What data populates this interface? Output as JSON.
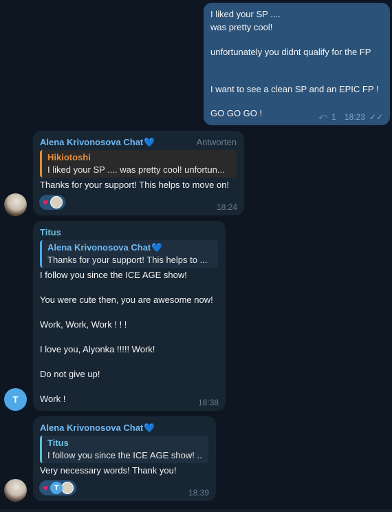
{
  "outgoing": {
    "lines": [
      "I liked your SP ....",
      "was pretty cool!",
      "unfortunately you didnt qualify for the FP",
      "I want to see a clean SP and an EPIC FP !",
      "GO GO GO !"
    ],
    "reply_count": "1",
    "time": "18:23"
  },
  "msg1": {
    "sender": "Alena Krivonosova Chat",
    "reply_action": "Antworten",
    "quote_name": "Hikiotoshi",
    "quote_text": "I liked your SP ....  was pretty cool!  unfortun...",
    "text": "Thanks for your support! This helps to move on!",
    "time": "18:24"
  },
  "msg2": {
    "sender": "Titus",
    "quote_name": "Alena Krivonosova Chat",
    "quote_text": "Thanks for your support! This helps to ...",
    "lines": [
      "I follow you since the ICE AGE show!",
      "You were cute then, you are awesome now!",
      "Work, Work, Work ! ! !",
      "I love you, Alyonka !!!!!  Work!",
      "Do not give up!",
      "Work !"
    ],
    "time": "18:38",
    "avatar_letter": "T"
  },
  "msg3": {
    "sender": "Alena Krivonosova Chat",
    "quote_name": "Titus",
    "quote_text": "I follow you since the ICE AGE show!  ...",
    "text": "Very necessary words! Thank you!",
    "time": "18:39",
    "reaction_letter": "T"
  },
  "icons": {
    "heart_blue": "💙",
    "heart_red": "♥",
    "reply_arrow": "⤺",
    "double_check": "✓✓"
  },
  "colors": {
    "background": "#0e1621",
    "outgoing_bubble": "#2b5278",
    "incoming_bubble": "#182533",
    "accent_blue": "#71baf4",
    "accent_orange": "#e58e3a"
  }
}
